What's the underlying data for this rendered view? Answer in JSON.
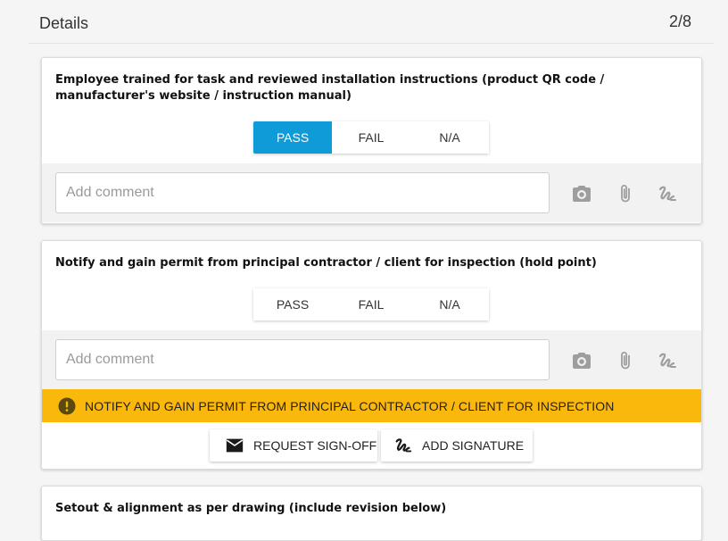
{
  "header": {
    "title": "Details",
    "count": "2/8"
  },
  "questions": [
    {
      "text": "Employee trained for task and reviewed installation instructions (product QR code / manufacturer's website / instruction manual)",
      "options": [
        "PASS",
        "FAIL",
        "N/A"
      ],
      "selected": "PASS",
      "comment_placeholder": "Add comment"
    },
    {
      "text": "Notify and gain permit from principal contractor / client for inspection (hold point)",
      "options": [
        "PASS",
        "FAIL",
        "N/A"
      ],
      "selected": "",
      "comment_placeholder": "Add comment",
      "warning": "NOTIFY AND GAIN PERMIT FROM PRINCIPAL CONTRACTOR / CLIENT FOR INSPECTION",
      "actions": {
        "request_signoff": "REQUEST SIGN-OFF",
        "add_signature": "ADD SIGNATURE"
      }
    },
    {
      "text": "Setout & alignment as per drawing (include revision below)"
    }
  ],
  "icons": {
    "camera": "camera-icon",
    "attach": "paperclip-icon",
    "signature": "signature-icon",
    "warning": "warning-icon",
    "mail": "envelope-icon"
  },
  "colors": {
    "selected": "#0f9ad8",
    "warning_bg": "#fbb80c",
    "icon_gray": "#9e9e9e"
  }
}
